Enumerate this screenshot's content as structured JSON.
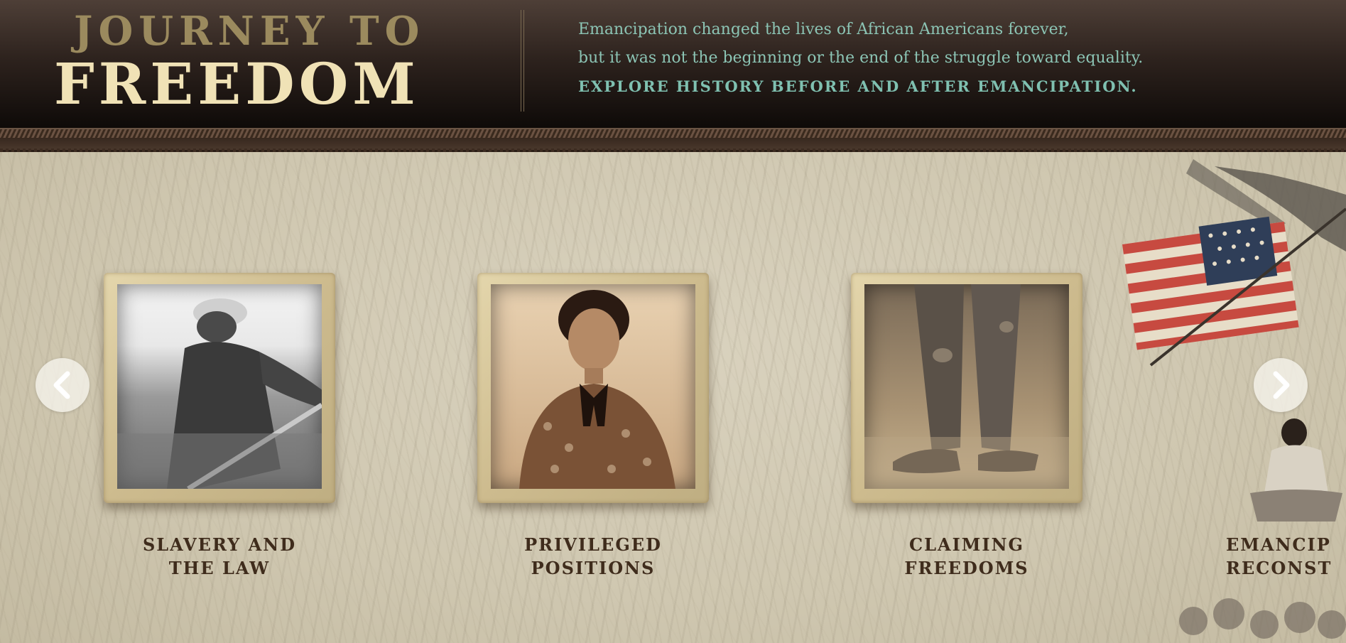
{
  "header": {
    "logo_top": "JOURNEY TO",
    "logo_bottom": "FREEDOM",
    "tagline_line1": "Emancipation changed the lives of African Americans forever,",
    "tagline_line2": "but it was not the beginning or the end of the struggle toward equality.",
    "tagline_cta": "EXPLORE HISTORY BEFORE AND AFTER EMANCIPATION."
  },
  "carousel": {
    "cards": [
      {
        "title_line1": "SLAVERY AND",
        "title_line2": "THE LAW"
      },
      {
        "title_line1": "PRIVILEGED",
        "title_line2": "POSITIONS"
      },
      {
        "title_line1": "CLAIMING",
        "title_line2": "FREEDOMS"
      }
    ],
    "partial_card": {
      "title_line1": "EMANCIP",
      "title_line2": "RECONST"
    },
    "prev_icon": "chevron-left-icon",
    "next_icon": "chevron-right-icon"
  },
  "colors": {
    "header_bg": "#2e231e",
    "logo_cream": "#f0e2b6",
    "logo_gold": "#9b8a5e",
    "tagline_teal": "#8cc5b5",
    "card_title": "#3f2c1c",
    "stage_bg": "#d4ccb6"
  }
}
